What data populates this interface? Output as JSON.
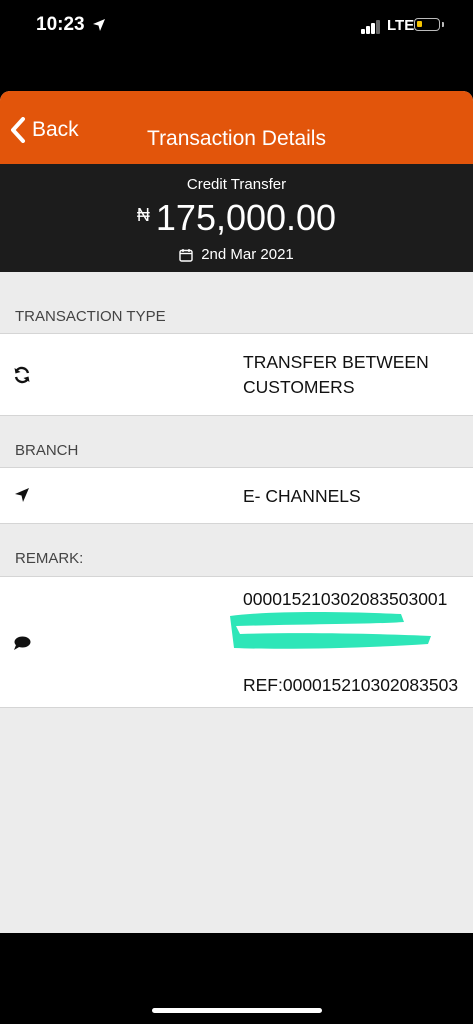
{
  "status_bar": {
    "time": "10:23",
    "network": "LTE",
    "location_icon": "location-arrow-icon",
    "signal_icon": "signal-bars-icon",
    "battery_icon": "battery-low-icon",
    "battery_color": "#f5c400"
  },
  "nav": {
    "back_label": "Back",
    "title": "Transaction Details",
    "back_icon": "chevron-left-icon",
    "bar_color": "#e2550b"
  },
  "summary": {
    "type": "Credit Transfer",
    "currency_symbol": "₦",
    "amount": "175,000.00",
    "date": "2nd Mar 2021",
    "date_icon": "calendar-icon"
  },
  "sections": {
    "transaction_type": {
      "label": "TRANSACTION TYPE",
      "icon": "refresh-icon",
      "value_line1": "TRANSFER BETWEEN",
      "value_line2": "CUSTOMERS"
    },
    "branch": {
      "label": "BRANCH",
      "icon": "location-arrow-icon",
      "value": "E- CHANNELS"
    },
    "remark": {
      "label": "REMARK:",
      "icon": "speech-bubble-icon",
      "value_line1": "000015210302083503001",
      "value_line3": "REF:000015210302083503",
      "redaction_color": "#2ee6b8"
    }
  }
}
